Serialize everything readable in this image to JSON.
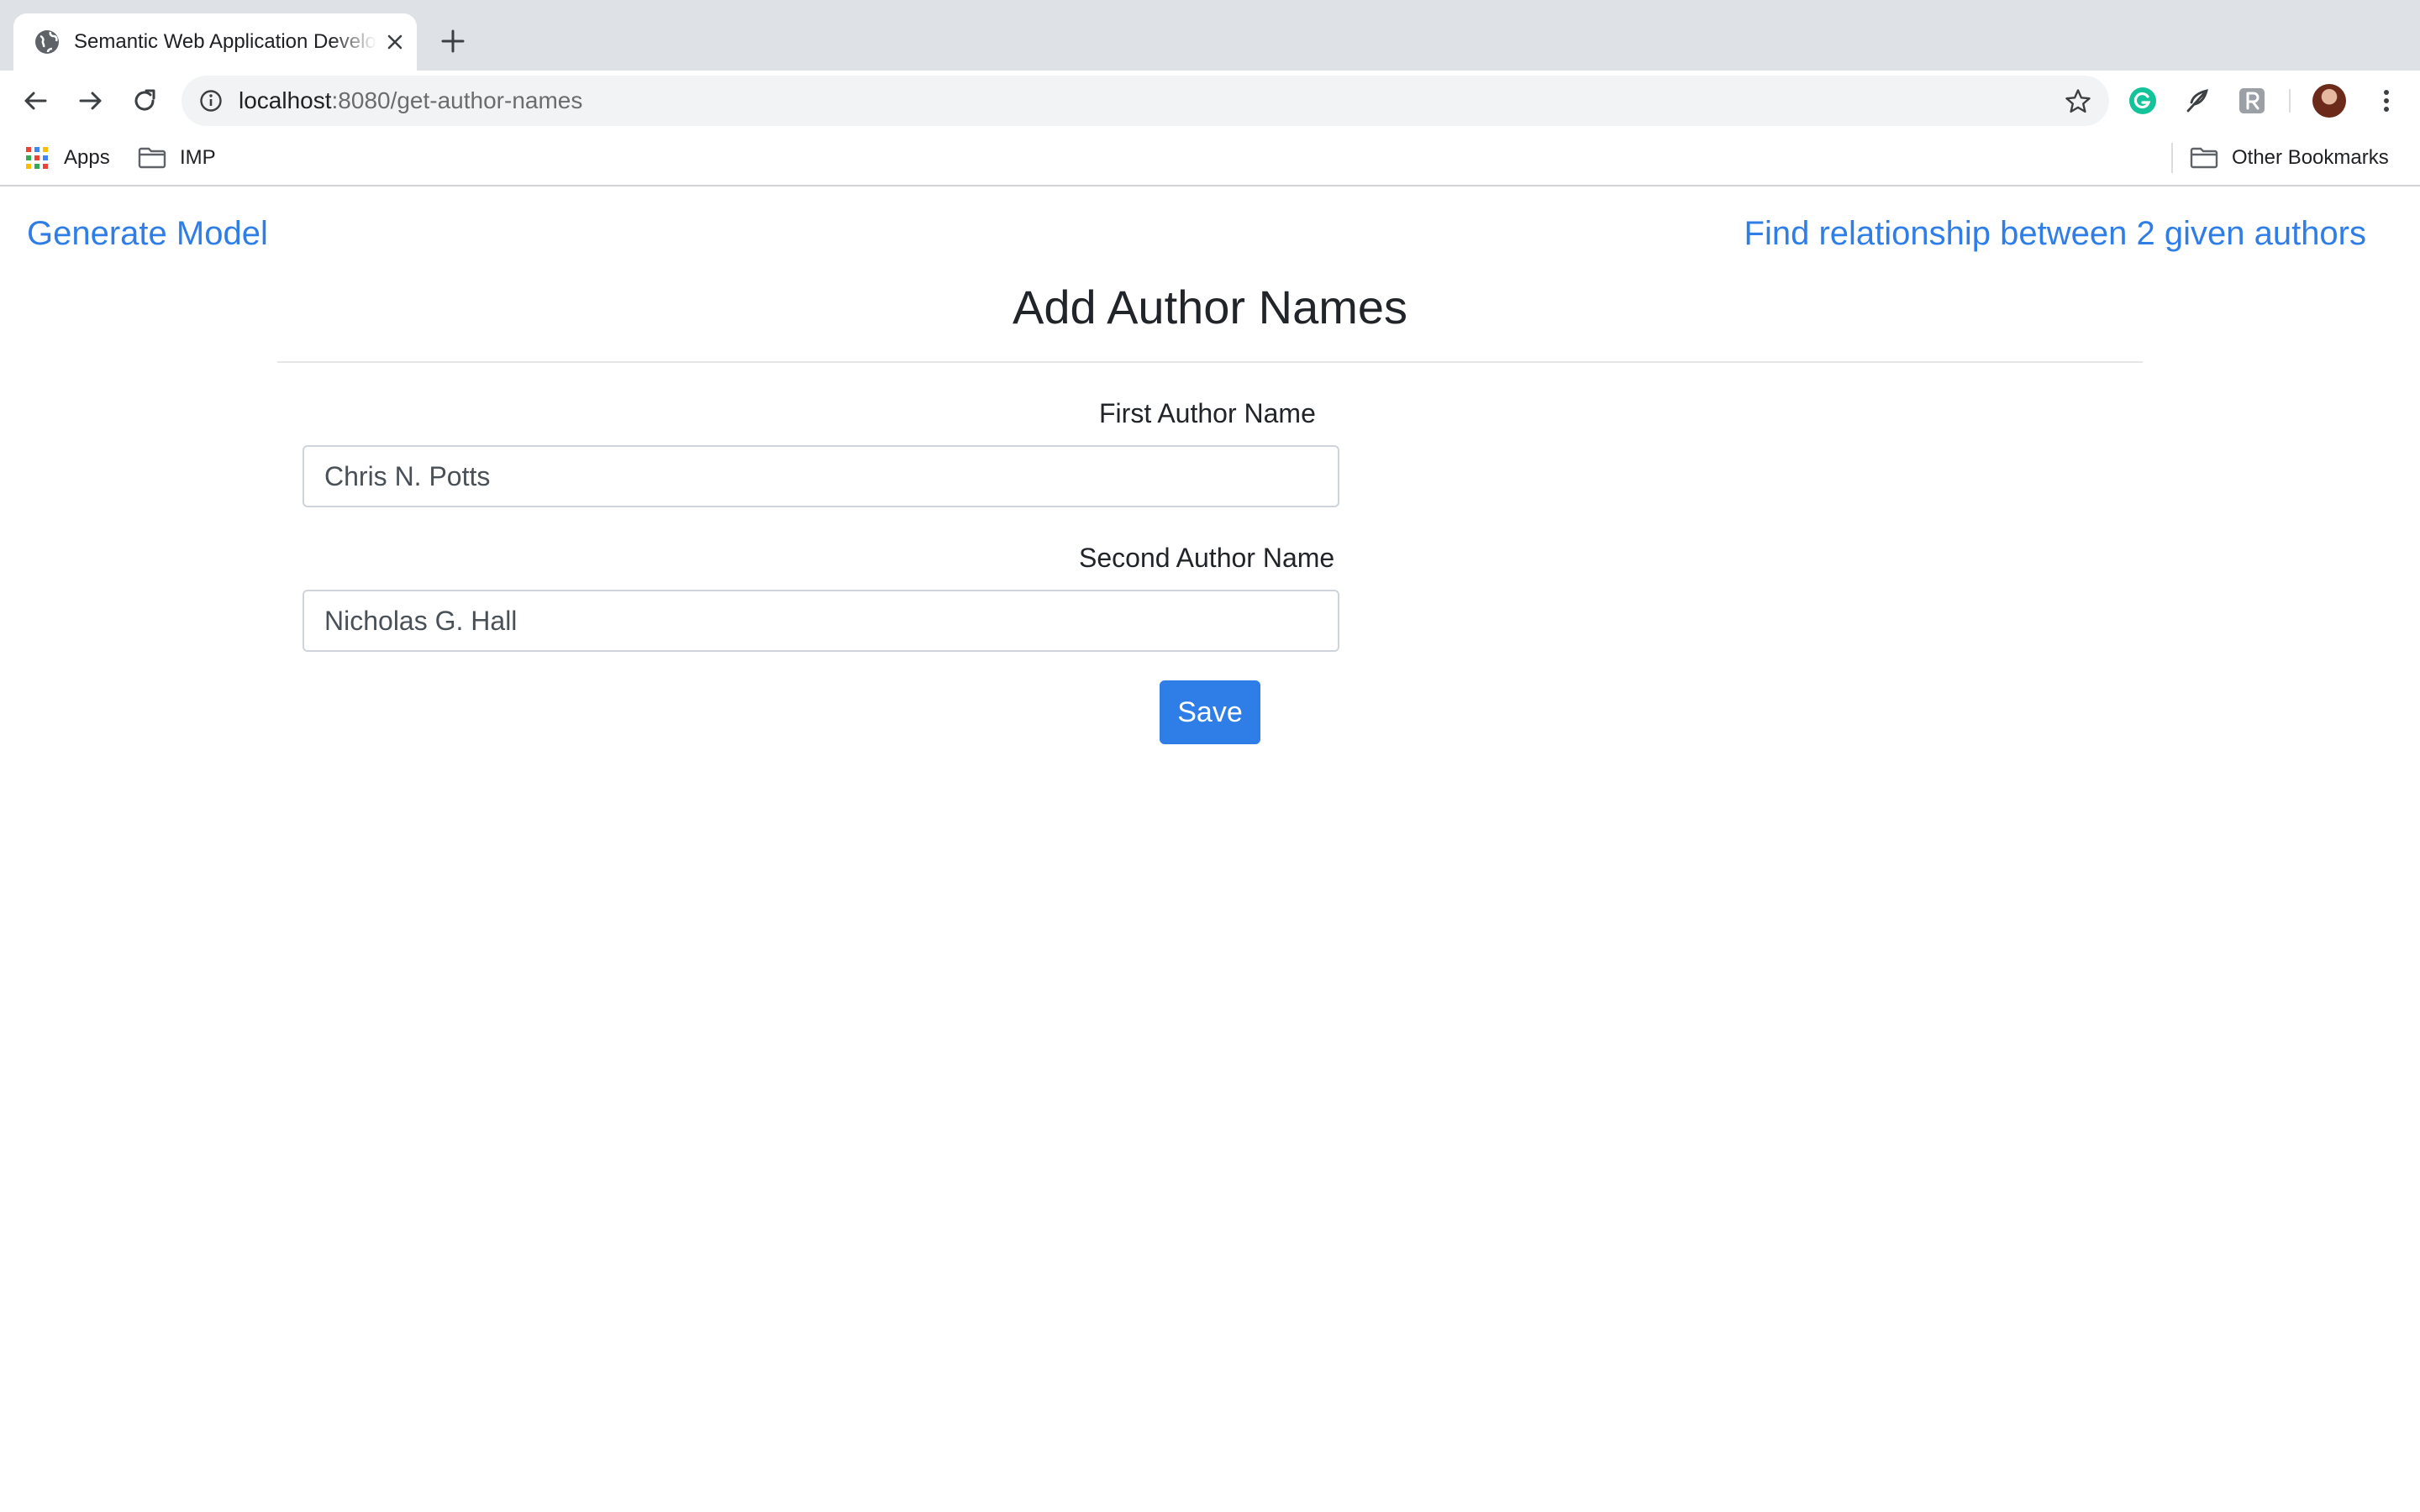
{
  "browser": {
    "tab": {
      "title": "Semantic Web Application Development",
      "favicon": "globe-icon"
    },
    "url": {
      "host": "localhost",
      "rest": ":8080/get-author-names"
    },
    "bookmarks": {
      "apps": "Apps",
      "imp": "IMP",
      "other": "Other Bookmarks"
    },
    "colors": {
      "tabstrip": "#dee1e6",
      "omnibox": "#f1f3f4",
      "grammarly": "#15c39a"
    }
  },
  "page": {
    "nav": {
      "left_link": "Generate Model",
      "right_link": "Find relationship between 2 given authors"
    },
    "title": "Add Author Names",
    "form": {
      "first_label": "First Author Name",
      "first_value": "Chris N. Potts",
      "second_label": "Second Author Name",
      "second_value": "Nicholas G. Hall",
      "save_label": "Save"
    },
    "colors": {
      "link": "#2f7ee8",
      "primary_button": "#2f7ee8",
      "heading": "#212529"
    }
  }
}
